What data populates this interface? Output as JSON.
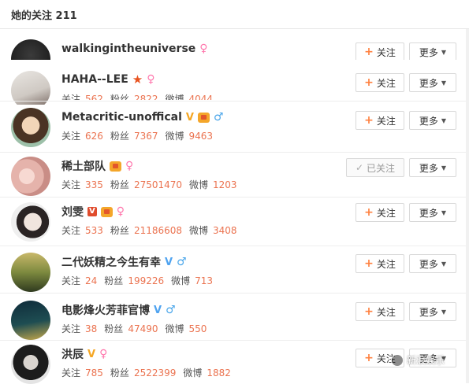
{
  "header": {
    "title": "她的关注 211"
  },
  "labels": {
    "follow": "关注",
    "followed": "已关注",
    "more": "更多",
    "guanzhu": "关注",
    "fensi": "粉丝",
    "weibo": "微博"
  },
  "users": [
    {
      "name": "walkingintheuniverse",
      "badges": [
        "female"
      ],
      "guanzhu": "",
      "fensi": "",
      "weibo": "",
      "followed": false
    },
    {
      "name": "HAHA--LEE",
      "badges": [
        "star",
        "female"
      ],
      "guanzhu": "562",
      "fensi": "2822",
      "weibo": "4044",
      "followed": false
    },
    {
      "name": "Metacritic-unoffical",
      "badges": [
        "v-gold",
        "gift",
        "male"
      ],
      "guanzhu": "626",
      "fensi": "7367",
      "weibo": "9463",
      "followed": false
    },
    {
      "name": "稀土部队",
      "badges": [
        "gift",
        "female"
      ],
      "guanzhu": "335",
      "fensi": "27501470",
      "weibo": "1203",
      "followed": true
    },
    {
      "name": "刘雯",
      "badges": [
        "v-red",
        "gift",
        "female"
      ],
      "guanzhu": "533",
      "fensi": "21186608",
      "weibo": "3408",
      "followed": false
    },
    {
      "name": "二代妖精之今生有幸",
      "badges": [
        "v-blue",
        "male"
      ],
      "guanzhu": "24",
      "fensi": "199226",
      "weibo": "713",
      "followed": false
    },
    {
      "name": "电影烽火芳菲官博",
      "badges": [
        "v-blue",
        "male"
      ],
      "guanzhu": "38",
      "fensi": "47490",
      "weibo": "550",
      "followed": false
    },
    {
      "name": "洪辰",
      "badges": [
        "v-gold",
        "female"
      ],
      "guanzhu": "785",
      "fensi": "2522399",
      "weibo": "1882",
      "followed": false
    }
  ],
  "watermark": {
    "text": "新浪娱乐"
  },
  "colors": {
    "accent": "#eb7350",
    "plus": "#ff8140",
    "male": "#4aa6ea",
    "female": "#ff77ad"
  }
}
